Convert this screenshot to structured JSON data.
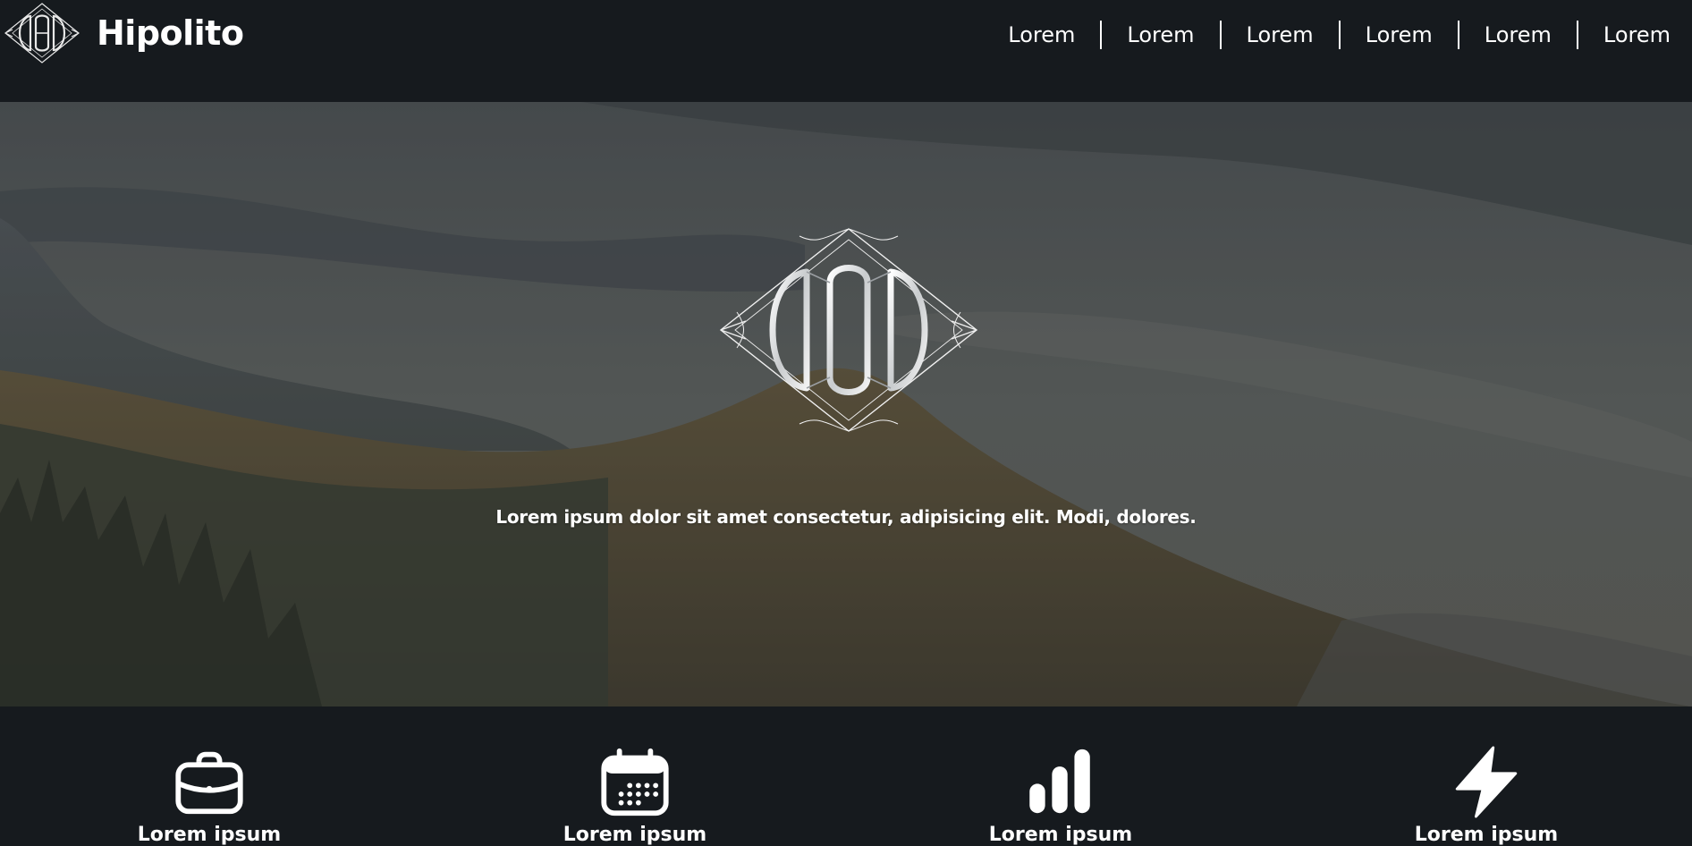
{
  "brand": {
    "name": "Hipolito",
    "logo_icon": "diamond-monogram-logo"
  },
  "nav": {
    "items": [
      {
        "label": "Lorem"
      },
      {
        "label": "Lorem"
      },
      {
        "label": "Lorem"
      },
      {
        "label": "Lorem"
      },
      {
        "label": "Lorem"
      },
      {
        "label": "Lorem"
      }
    ]
  },
  "hero": {
    "emblem_icon": "diamond-monogram-emblem",
    "background": "mountain-landscape-photo",
    "tagline": "Lorem ipsum dolor sit amet consectetur, adipisicing elit. Modi, dolores."
  },
  "features": [
    {
      "icon": "briefcase-icon",
      "label": "Lorem ipsum"
    },
    {
      "icon": "calendar-icon",
      "label": "Lorem ipsum"
    },
    {
      "icon": "bar-chart-icon",
      "label": "Lorem ipsum"
    },
    {
      "icon": "lightning-icon",
      "label": "Lorem ipsum"
    }
  ],
  "colors": {
    "background": "#161a1e",
    "text": "#ffffff"
  }
}
